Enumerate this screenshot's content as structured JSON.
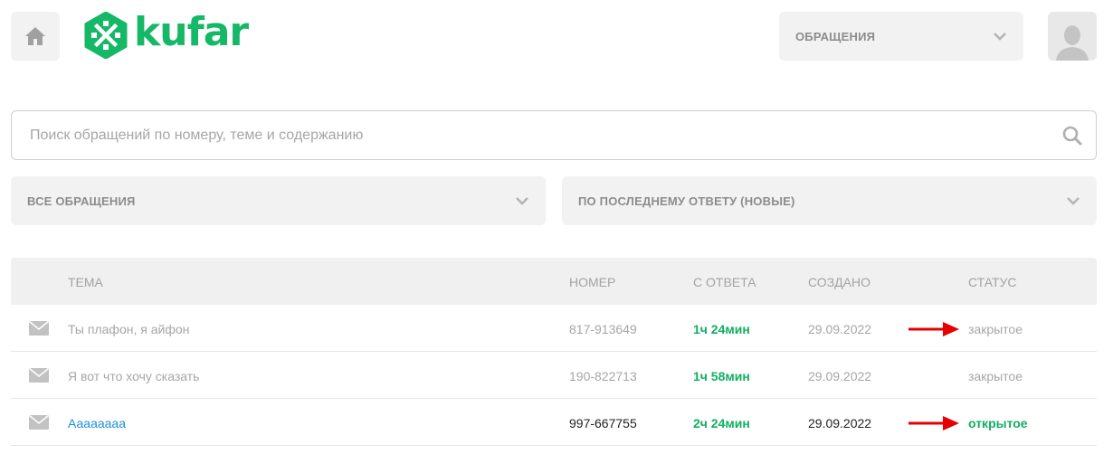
{
  "header": {
    "logo_text": "kufar",
    "nav_select": "ОБРАЩЕНИЯ",
    "icons": {
      "home": "home-icon",
      "avatar": "user-avatar-icon",
      "chevron": "chevron-down-icon"
    }
  },
  "search": {
    "placeholder": "Поиск обращений по номеру, теме и содержанию",
    "value": ""
  },
  "filters": {
    "type": "ВСЕ ОБРАЩЕНИЯ",
    "sort": "ПО ПОСЛЕДНЕМУ ОТВЕТУ (НОВЫЕ)"
  },
  "table": {
    "columns": [
      "ТЕМА",
      "НОМЕР",
      "С ОТВЕТА",
      "СОЗДАНО",
      "СТАТУС"
    ],
    "rows": [
      {
        "topic": "Ты плафон, я айфон",
        "number": "817-913649",
        "since": "1ч 24мин",
        "created": "29.09.2022",
        "status": "закрытое",
        "state": "closed"
      },
      {
        "topic": "Я вот что хочу сказать",
        "number": "190-822713",
        "since": "1ч 58мин",
        "created": "29.09.2022",
        "status": "закрытое",
        "state": "closed"
      },
      {
        "topic": "Ааааaaaa",
        "number": "997-667755",
        "since": "2ч 24мин",
        "created": "29.09.2022",
        "status": "открытое",
        "state": "open"
      }
    ]
  },
  "colors": {
    "brand": "#14b866",
    "link": "#1a8fd8",
    "annotation_arrow": "#e60000"
  }
}
